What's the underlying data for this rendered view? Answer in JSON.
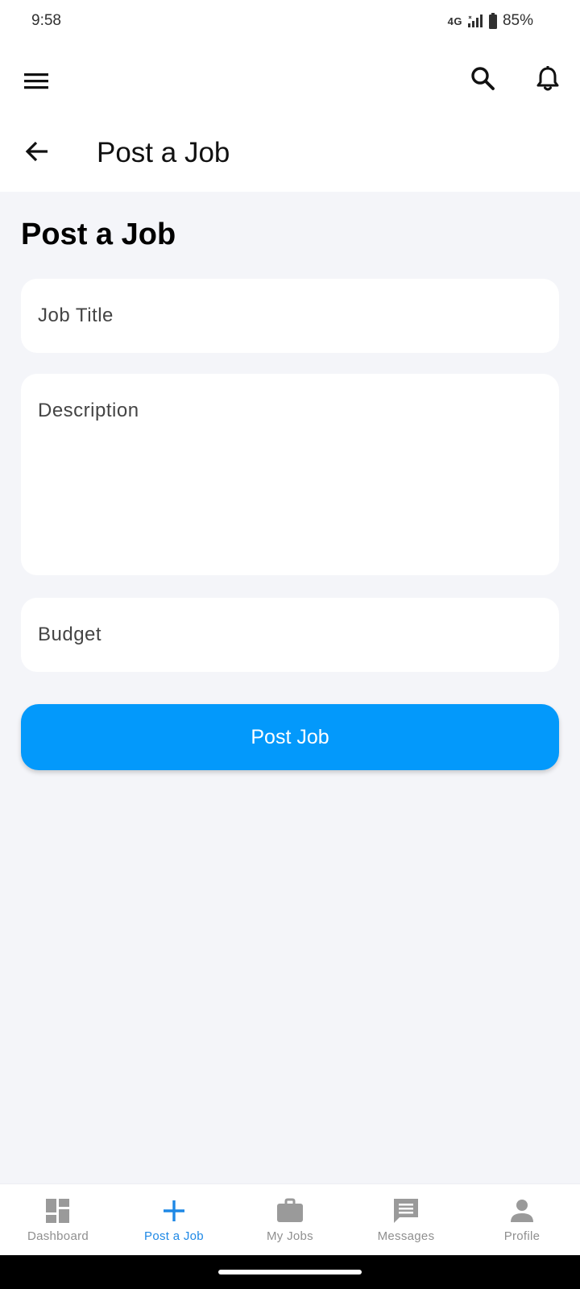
{
  "status_bar": {
    "time": "9:58",
    "network": "4G",
    "battery": "85%"
  },
  "app_bar": {
    "menu_icon": "hamburger-menu-icon",
    "search_icon": "search-icon",
    "notification_icon": "bell-icon"
  },
  "header": {
    "back_icon": "arrow-left-icon",
    "title": "Post a Job"
  },
  "form": {
    "heading": "Post a Job",
    "job_title_placeholder": "Job Title",
    "description_placeholder": "Description",
    "budget_placeholder": "Budget",
    "submit_label": "Post Job"
  },
  "bottom_nav": {
    "items": [
      {
        "label": "Dashboard",
        "icon": "dashboard-icon",
        "active": false
      },
      {
        "label": "Post a Job",
        "icon": "plus-icon",
        "active": true
      },
      {
        "label": "My Jobs",
        "icon": "briefcase-icon",
        "active": false
      },
      {
        "label": "Messages",
        "icon": "message-icon",
        "active": false
      },
      {
        "label": "Profile",
        "icon": "person-icon",
        "active": false
      }
    ]
  },
  "colors": {
    "accent": "#0399fb",
    "active_nav": "#1e88e5",
    "inactive_nav": "#8f8f8f",
    "background": "#f4f5f9"
  }
}
